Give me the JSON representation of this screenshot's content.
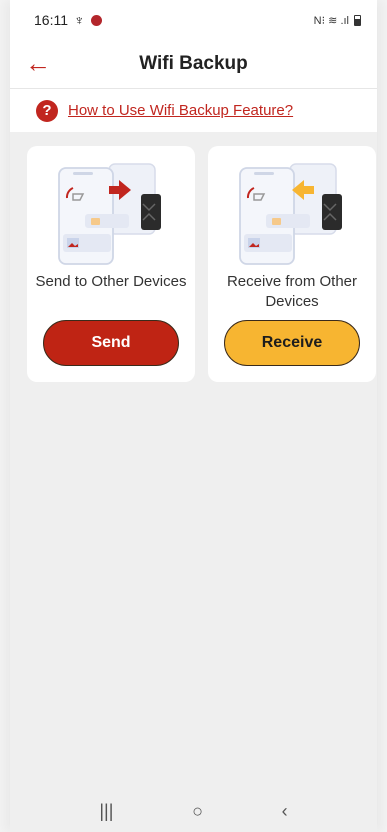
{
  "status": {
    "time": "16:11",
    "usb_symbol": "♆",
    "right": "N⁝ ≋ .ıl"
  },
  "appbar": {
    "back_glyph": "←",
    "title": "Wifi Backup"
  },
  "help": {
    "icon_glyph": "?",
    "link_text": "How to Use Wifi Backup Feature?"
  },
  "cards": [
    {
      "label": "Send to Other Devices",
      "button": "Send"
    },
    {
      "label": "Receive from Other Devices",
      "button": "Receive"
    }
  ],
  "nav": {
    "recents": "|||",
    "home": "○",
    "back": "‹"
  },
  "colors": {
    "accent_red": "#c1261f",
    "accent_yellow": "#f7b531"
  }
}
